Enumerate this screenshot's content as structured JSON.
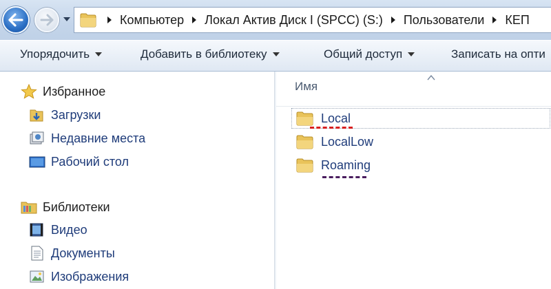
{
  "address": {
    "crumbs": [
      {
        "label": "Компьютер"
      },
      {
        "label": "Локал Актив Диск I (SPCC) (S:)"
      },
      {
        "label": "Пользователи"
      },
      {
        "label": "КЕП"
      }
    ]
  },
  "toolbar": {
    "organize": "Упорядочить",
    "add_library": "Добавить в библиотеку",
    "share": "Общий доступ",
    "burn": "Записать на опти"
  },
  "nav": {
    "favorites": {
      "label": "Избранное",
      "items": [
        {
          "label": "Загрузки",
          "icon": "downloads-folder-icon"
        },
        {
          "label": "Недавние места",
          "icon": "recent-places-icon"
        },
        {
          "label": "Рабочий стол",
          "icon": "desktop-icon"
        }
      ]
    },
    "libraries": {
      "label": "Библиотеки",
      "items": [
        {
          "label": "Видео",
          "icon": "video-library-icon"
        },
        {
          "label": "Документы",
          "icon": "documents-library-icon"
        },
        {
          "label": "Изображения",
          "icon": "pictures-library-icon"
        }
      ]
    }
  },
  "content": {
    "column_name": "Имя",
    "files": [
      {
        "name": "Local",
        "focused": true,
        "annotation": "red-dashed-underline"
      },
      {
        "name": "LocalLow",
        "focused": false
      },
      {
        "name": "Roaming",
        "focused": false,
        "annotation": "purple-dashed-underline"
      }
    ]
  },
  "colors": {
    "link_blue": "#1f3c7a",
    "annotation_red": "#d81e1e",
    "annotation_purple": "#4a1d5e",
    "folder_yellow": "#e9c35a"
  }
}
